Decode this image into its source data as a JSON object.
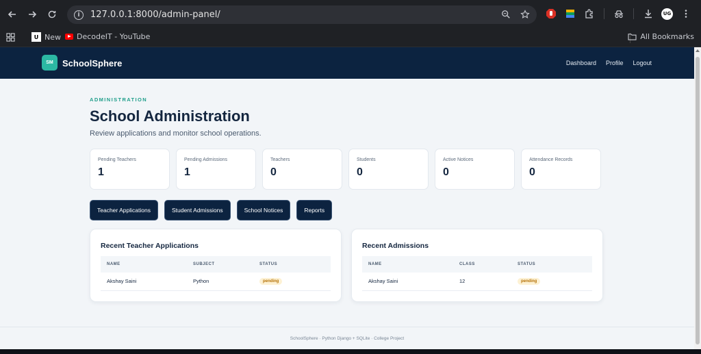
{
  "browser": {
    "url": "127.0.0.1:8000/admin-panel/",
    "profile_initials": "UG",
    "bookmarks": [
      {
        "label": "New"
      },
      {
        "label": "DecodeIT - YouTube"
      }
    ],
    "all_bookmarks_label": "All Bookmarks"
  },
  "site": {
    "logo_text": "SM",
    "brand": "SchoolSphere",
    "nav": [
      "Dashboard",
      "Profile",
      "Logout"
    ]
  },
  "header": {
    "eyebrow": "ADMINISTRATION",
    "title": "School Administration",
    "subtitle": "Review applications and monitor school operations."
  },
  "stats": [
    {
      "label": "Pending Teachers",
      "value": "1"
    },
    {
      "label": "Pending Admissions",
      "value": "1"
    },
    {
      "label": "Teachers",
      "value": "0"
    },
    {
      "label": "Students",
      "value": "0"
    },
    {
      "label": "Active Notices",
      "value": "0"
    },
    {
      "label": "Attendance Records",
      "value": "0"
    }
  ],
  "actions": [
    "Teacher Applications",
    "Student Admissions",
    "School Notices",
    "Reports"
  ],
  "teacher_applications": {
    "title": "Recent Teacher Applications",
    "columns": [
      "NAME",
      "SUBJECT",
      "STATUS"
    ],
    "rows": [
      {
        "name": "Akshay Saini",
        "subject": "Python",
        "status": "pending"
      }
    ]
  },
  "admissions": {
    "title": "Recent Admissions",
    "columns": [
      "NAME",
      "CLASS",
      "STATUS"
    ],
    "rows": [
      {
        "name": "Akshay Saini",
        "class": "12",
        "status": "pending"
      }
    ]
  },
  "footer": "SchoolSphere · Python Django + SQLite · College Project",
  "colors": {
    "navbar": "#0c2340",
    "accent": "#2cb8a3",
    "pending_badge_bg": "#fdf1d3",
    "pending_badge_text": "#b57207"
  }
}
